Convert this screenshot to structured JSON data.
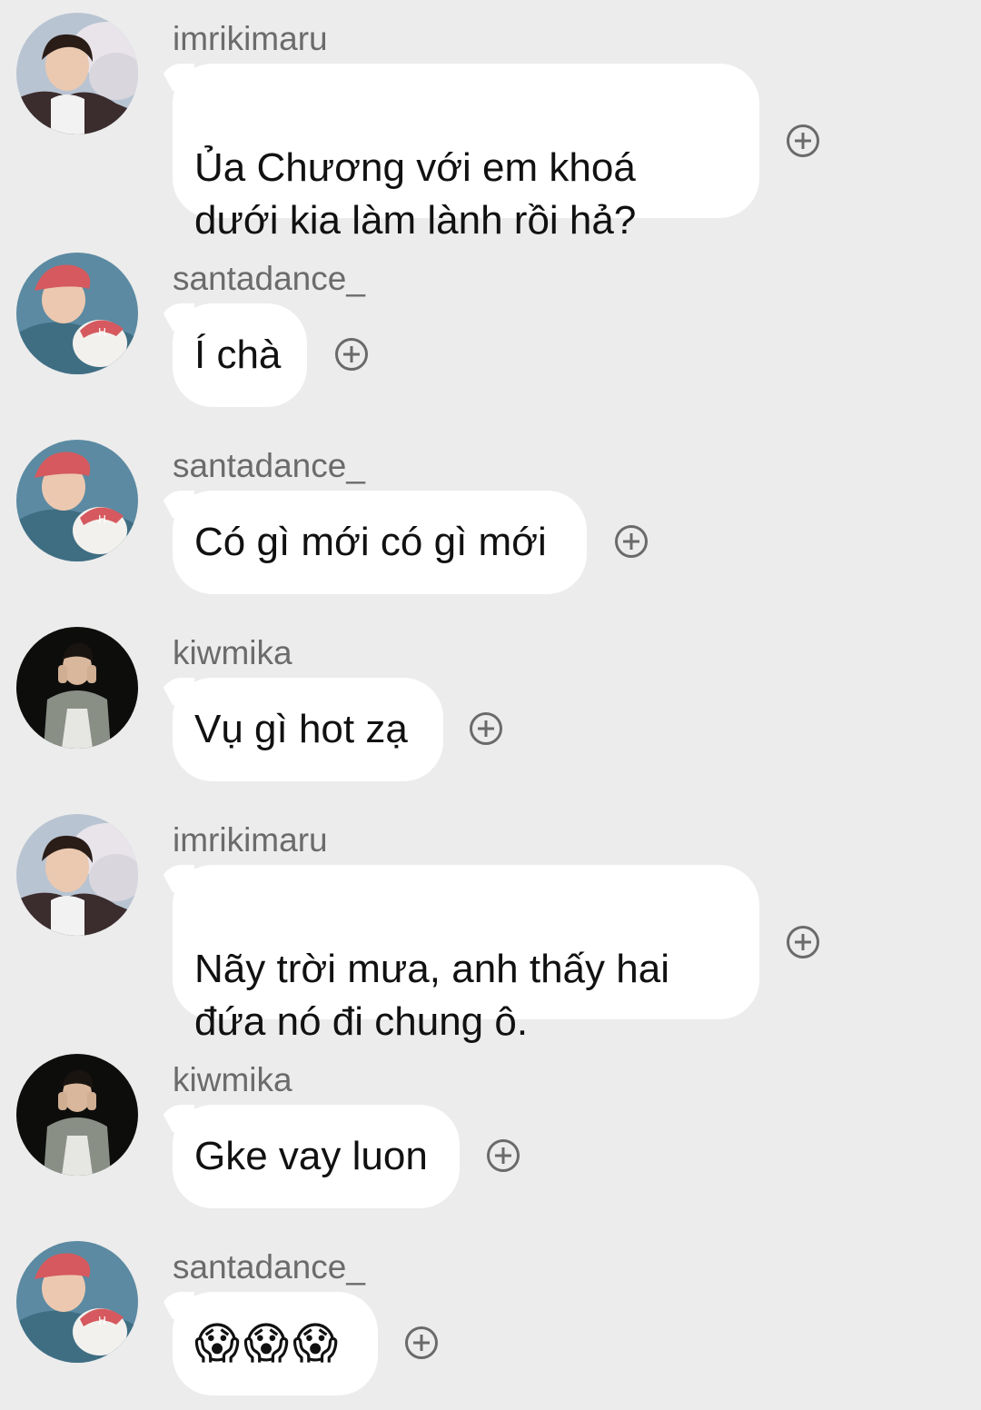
{
  "messages": [
    {
      "user": "imrikimaru",
      "avatar": "avatar-rikimaru-icon",
      "text": "Ủa Chương với em khoá\ndưới kia làm lành rồi hả?"
    },
    {
      "user": "santadance_",
      "avatar": "avatar-santa-icon",
      "text": "Í chà"
    },
    {
      "user": "santadance_",
      "avatar": "avatar-santa-icon",
      "text": "Có gì mới có gì mới"
    },
    {
      "user": "kiwmika",
      "avatar": "avatar-kiwmika-icon",
      "text": "Vụ gì hot zạ"
    },
    {
      "user": "imrikimaru",
      "avatar": "avatar-rikimaru-icon",
      "text": "Nãy trời mưa, anh thấy hai\nđứa nó đi chung ô."
    },
    {
      "user": "kiwmika",
      "avatar": "avatar-kiwmika-icon",
      "text": "Gke vay luon"
    },
    {
      "user": "santadance_",
      "avatar": "avatar-santa-icon",
      "text": "😱😱😱"
    }
  ],
  "colors": {
    "background": "#ececec",
    "bubble": "#ffffff",
    "username": "#6b6b6b",
    "icon": "#6a6a6a"
  }
}
